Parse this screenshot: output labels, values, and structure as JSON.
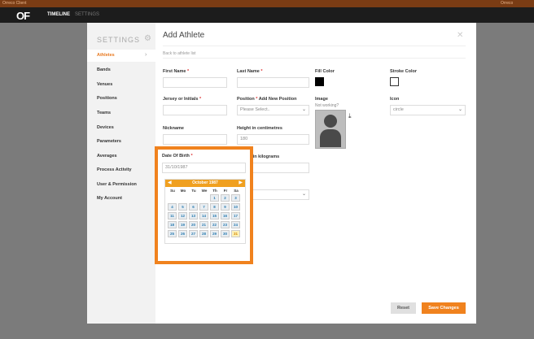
{
  "topbar": {
    "left_text": "Orreco Client",
    "right_text": "Orreco"
  },
  "appbar": {
    "logo": "OF",
    "nav": [
      "TIMELINE",
      "SETTINGS"
    ]
  },
  "settings": {
    "title": "SETTINGS",
    "items": [
      {
        "label": "Athletes",
        "active": true
      },
      {
        "label": "Bands"
      },
      {
        "label": "Venues"
      },
      {
        "label": "Positions"
      },
      {
        "label": "Teams"
      },
      {
        "label": "Devices"
      },
      {
        "label": "Parameters"
      },
      {
        "label": "Averages"
      },
      {
        "label": "Process Activity"
      },
      {
        "label": "User & Permission"
      },
      {
        "label": "My Account"
      }
    ]
  },
  "form": {
    "title": "Add Athlete",
    "back_link": "Back to athlete list",
    "first_name_label": "First Name",
    "last_name_label": "Last Name",
    "fill_color_label": "Fill Color",
    "stroke_color_label": "Stroke Color",
    "jersey_label": "Jersey or Initials",
    "position_label": "Position",
    "add_position_link": "Add New Position",
    "position_value": "Please Select..",
    "image_label": "Image",
    "not_working": "Not working?",
    "icon_label": "Icon",
    "icon_value": "circle",
    "nickname_label": "Nickname",
    "height_label": "Height in centimetres",
    "height_value": "180",
    "dob_label": "Date Of Birth",
    "dob_value": "31/10/1987",
    "weight_label": "Weight in kilograms",
    "weight_value": "200",
    "fill_color": "#000000",
    "stroke_color": "#ffffff"
  },
  "calendar": {
    "month_label": "October 1987",
    "dows": [
      "Su",
      "Mo",
      "Tu",
      "We",
      "Th",
      "Fr",
      "Sa"
    ],
    "first_weekday": 4,
    "days_in_month": 31,
    "selected_day": 31
  },
  "buttons": {
    "reset": "Reset",
    "save": "Save Changes"
  },
  "colors": {
    "accent": "#f0821e",
    "calendar_header": "#f0a020"
  }
}
